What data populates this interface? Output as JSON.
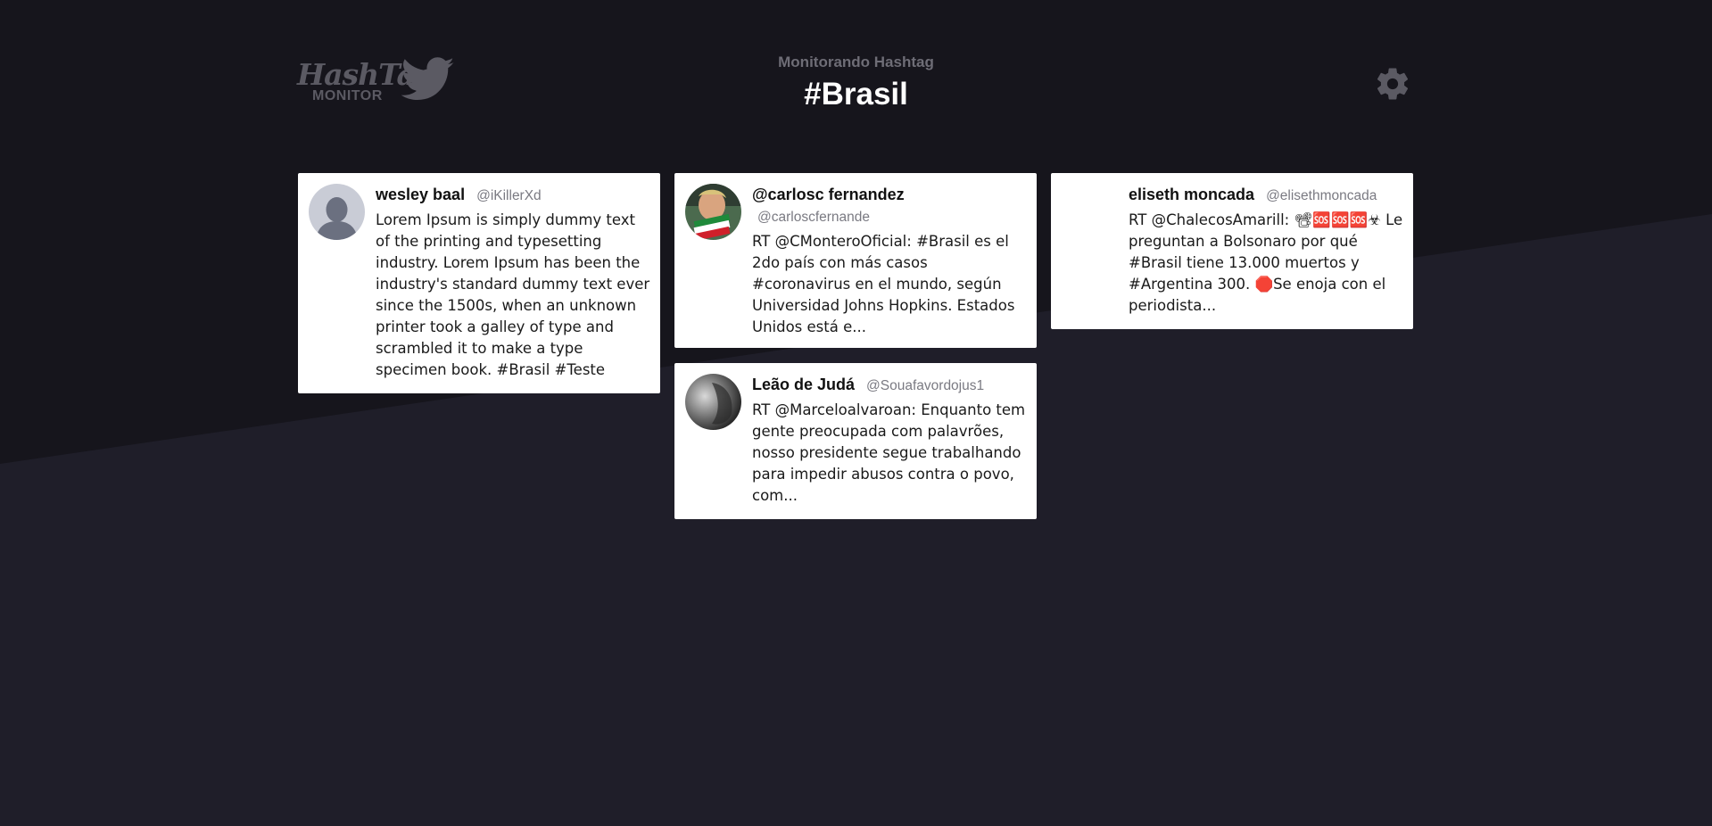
{
  "header": {
    "logo": {
      "hashtag_text": "HashTag",
      "monitor_text": "MONITOR"
    },
    "subtitle": "Monitorando Hashtag",
    "hashtag": "#Brasil",
    "settings_icon": "gear-icon"
  },
  "colors": {
    "background_top": "#16151c",
    "background_bottom": "#1f1e29",
    "card": "#ffffff",
    "logo_gray": "#5b5a63"
  },
  "tweets": [
    {
      "name": "wesley baal",
      "handle": "@iKillerXd",
      "text": "Lorem Ipsum is simply dummy text of the printing and typesetting industry. Lorem Ipsum has been the industry's standard dummy text ever since the 1500s, when an unknown printer took a galley of type and scrambled it to make a type specimen book. #Brasil #Teste"
    },
    {
      "name": "@carlosc fernandez",
      "handle": "@carloscfernande",
      "text": "RT @CMonteroOficial: #Brasil es el 2do país con más casos #coronavirus en el mundo, según Universidad Johns Hopkins. Estados Unidos está e..."
    },
    {
      "name": "eliseth moncada",
      "handle": "@elisethmoncada",
      "text": "RT @ChalecosAmarill: 📽🆘🆘🆘☣ Le preguntan a Bolsonaro por qué #Brasil tiene 13.000 muertos y #Argentina 300. 🛑Se enoja con el periodista..."
    },
    {
      "name": "Leão de Judá",
      "handle": "@Souafavordojus1",
      "text": "RT @Marceloalvaroan: Enquanto tem gente preocupada com palavrões, nosso presidente segue trabalhando para impedir abusos contra o povo, com..."
    }
  ]
}
